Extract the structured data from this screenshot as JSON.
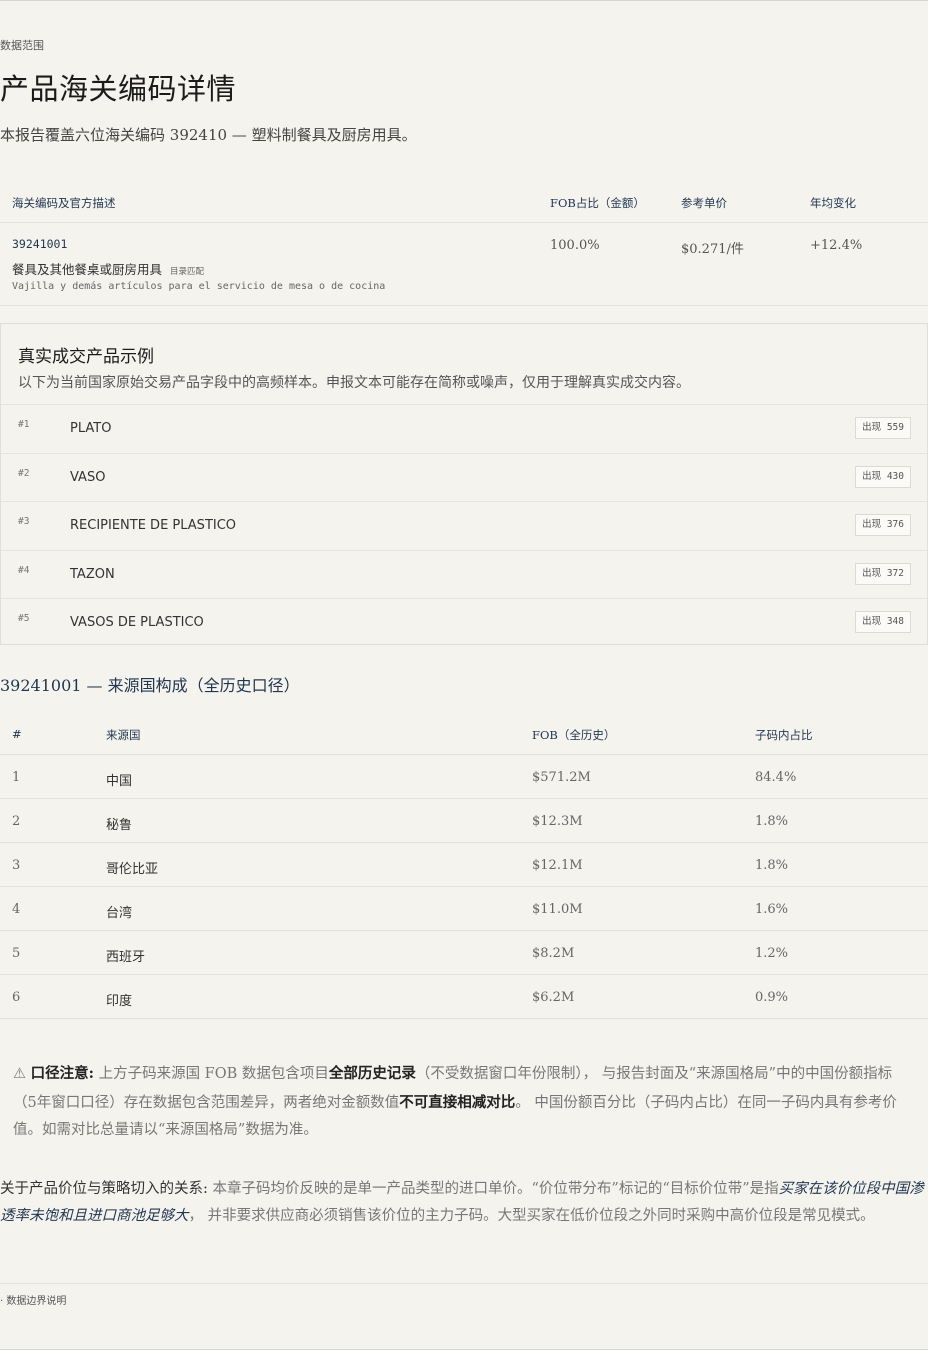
{
  "header": {
    "eyebrow": "数据范围",
    "title": "产品海关编码详情",
    "lede": "本报告覆盖六位海关编码 392410 — 塑料制餐具及厨房用具。"
  },
  "hs_table": {
    "columns": [
      "海关编码及官方描述",
      "FOB占比（金额）",
      "参考单价",
      "年均变化"
    ],
    "rows": [
      {
        "code": "39241001",
        "desc": "餐具及其他餐桌或厨房用具",
        "badge": "目录匹配",
        "desc_es": "Vajilla y demás artículos para el servicio de mesa o de cocina",
        "share": "100.0%",
        "unit_price": "$0.271/件",
        "growth": "+12.4%"
      }
    ]
  },
  "examples": {
    "title": "真实成交产品示例",
    "subtitle": "以下为当前国家原始交易产品字段中的高频样本。申报文本可能存在简称或噪声，仅用于理解真实成交内容。",
    "items": [
      {
        "rank": "#1",
        "name": "PLATO",
        "count": "出现 559"
      },
      {
        "rank": "#2",
        "name": "VASO",
        "count": "出现 430"
      },
      {
        "rank": "#3",
        "name": "RECIPIENTE DE PLASTICO",
        "count": "出现 376"
      },
      {
        "rank": "#4",
        "name": "TAZON",
        "count": "出现 372"
      },
      {
        "rank": "#5",
        "name": "VASOS DE PLASTICO",
        "count": "出现 348"
      }
    ]
  },
  "origin": {
    "title": "39241001 — 来源国构成（全历史口径）",
    "columns": [
      "#",
      "来源国",
      "FOB（全历史）",
      "子码内占比"
    ],
    "rows": [
      {
        "idx": "1",
        "country": "中国",
        "fob": "$571.2M",
        "share": "84.4%"
      },
      {
        "idx": "2",
        "country": "秘鲁",
        "fob": "$12.3M",
        "share": "1.8%"
      },
      {
        "idx": "3",
        "country": "哥伦比亚",
        "fob": "$12.1M",
        "share": "1.8%"
      },
      {
        "idx": "4",
        "country": "台湾",
        "fob": "$11.0M",
        "share": "1.6%"
      },
      {
        "idx": "5",
        "country": "西班牙",
        "fob": "$8.2M",
        "share": "1.2%"
      },
      {
        "idx": "6",
        "country": "印度",
        "fob": "$6.2M",
        "share": "0.9%"
      }
    ]
  },
  "note": {
    "icon": "⚠",
    "label": "口径注意:",
    "t1": "上方子码来源国 FOB 数据包含项目",
    "b1": "全部历史记录",
    "t2": "（不受数据窗口年份限制），  与报告封面及“来源国格局”中的中国份额指标（5年窗口口径）存在数据包含范围差异，两者绝对金额数值",
    "b2": "不可直接相减对比",
    "t3": "。 中国份额百分比（子码内占比）在同一子码内具有参考价值。如需对比总量请以“来源国格局”数据为准。"
  },
  "strategy": {
    "label": "关于产品价位与策略切入的关系:",
    "t1": "  本章子码均价反映的是单一产品类型的进口单价。“价位带分布”标记的“目标价位带”是指",
    "em": "买家在该价位段中国渗透率未饱和且进口商池足够大",
    "t2": "，  并非要求供应商必须销售该价位的主力子码。大型买家在低价位段之外同时采购中高价位段是常见模式。"
  },
  "footer": {
    "item": "· 数据边界说明"
  }
}
